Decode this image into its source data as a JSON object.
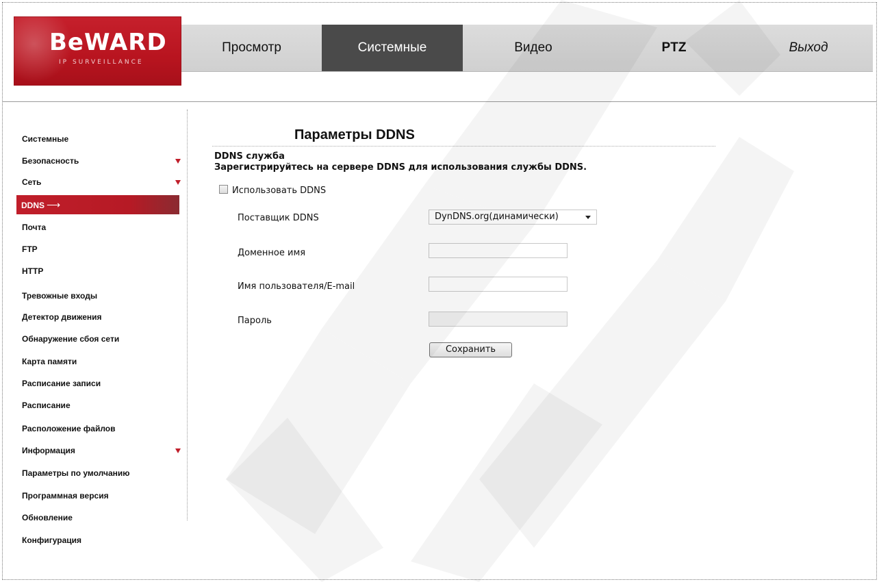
{
  "brand": {
    "logo_text": "BeWARD",
    "logo_subtitle": "IP SURVEILLANCE",
    "color": "#c01e2a"
  },
  "nav": {
    "items": [
      {
        "label": "Просмотр"
      },
      {
        "label": "Системные",
        "active": true
      },
      {
        "label": "Видео"
      },
      {
        "label": "PTZ"
      },
      {
        "label": "Выход"
      }
    ]
  },
  "sidebar": {
    "items": [
      {
        "label": "Системные"
      },
      {
        "label": "Безопасность",
        "submenu": true
      },
      {
        "label": "Сеть",
        "submenu": true
      },
      {
        "label": "DDNS",
        "active": true,
        "icon": "right-arrow-icon",
        "glyph": "⟶"
      },
      {
        "label": "Почта"
      },
      {
        "label": "FTP"
      },
      {
        "label": "HTTP"
      },
      {
        "label": "Тревожные входы"
      },
      {
        "label": "Детектор движения"
      },
      {
        "label": "Обнаружение сбоя сети"
      },
      {
        "label": "Карта памяти"
      },
      {
        "label": "Расписание записи"
      },
      {
        "label": "Расписание"
      },
      {
        "label": "Расположение файлов"
      },
      {
        "label": "Информация",
        "submenu": true
      },
      {
        "label": "Параметры по умолчанию"
      },
      {
        "label": "Программная версия"
      },
      {
        "label": "Обновление"
      },
      {
        "label": "Конфигурация"
      }
    ]
  },
  "main": {
    "title": "Параметры DDNS",
    "section_title": "DDNS служба",
    "section_desc": "Зарегистрируйтесь на сервере DDNS для использования службы DDNS.",
    "use_ddns": {
      "label": "Использовать DDNS",
      "checked": false
    },
    "provider": {
      "label": "Поставщик DDNS",
      "value": "DynDNS.org(динамически)"
    },
    "domain": {
      "label": "Доменное имя",
      "value": ""
    },
    "username": {
      "label": "Имя пользователя/E-mail",
      "value": ""
    },
    "password": {
      "label": "Пароль",
      "value": ""
    },
    "save_label": "Сохранить"
  }
}
